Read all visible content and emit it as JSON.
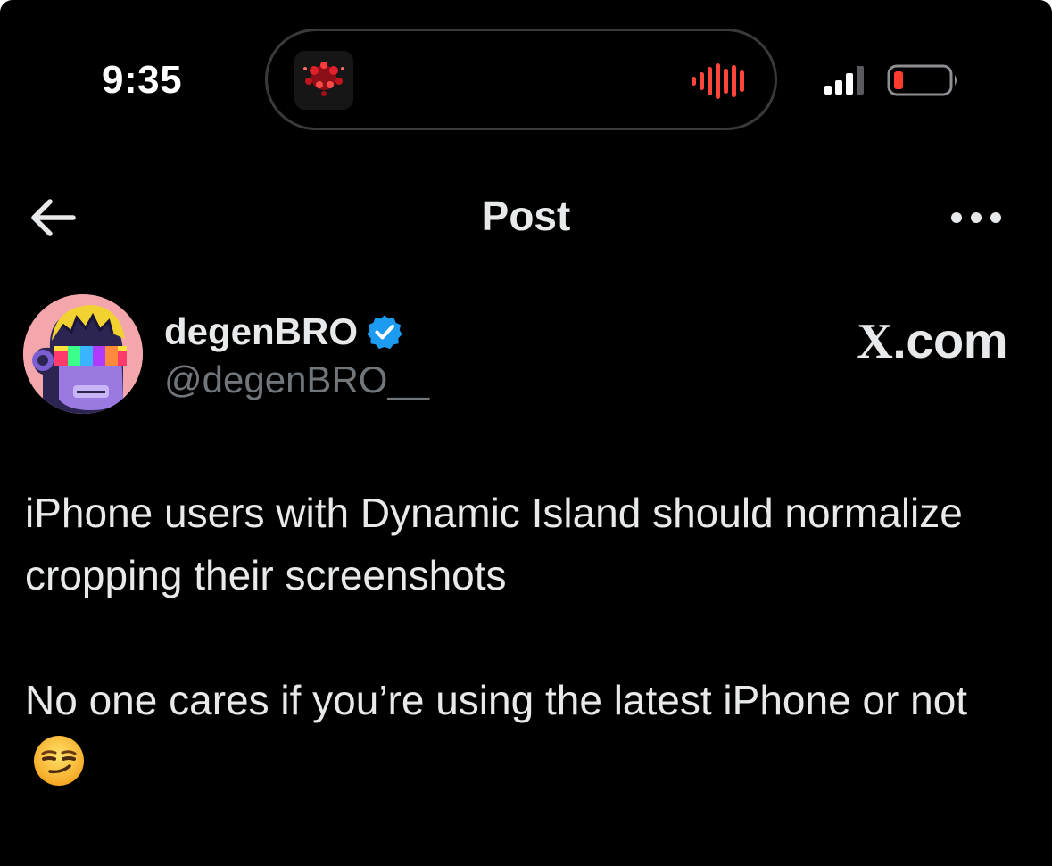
{
  "status_bar": {
    "time": "9:35",
    "signal_icon": "cellular-signal-icon",
    "battery_icon": "battery-low-icon",
    "battery_color": "#ff3b30"
  },
  "dynamic_island": {
    "album_icon": "album-art-icon",
    "waveform_icon": "audio-waveform-icon",
    "waveform_color": "#ff453a"
  },
  "nav": {
    "back_icon": "arrow-left-icon",
    "title": "Post",
    "more_icon": "more-dots-icon"
  },
  "author": {
    "display_name": "degenBRO",
    "handle": "@degenBRO__",
    "verified_icon": "verified-badge-icon",
    "verified_color": "#1d9bf0",
    "avatar_icon": "ape-avatar-icon"
  },
  "site_logo": {
    "x_letter": "X",
    "suffix": ".com"
  },
  "tweet": {
    "paragraph_1": "iPhone users with Dynamic Island should normalize cropping their screenshots",
    "paragraph_2": "No one cares if you’re using the latest iPhone or not",
    "emoji_icon": "smirking-face-icon"
  },
  "colors": {
    "background": "#000000",
    "text_primary": "#e7e9ea",
    "text_secondary": "#71767b"
  }
}
